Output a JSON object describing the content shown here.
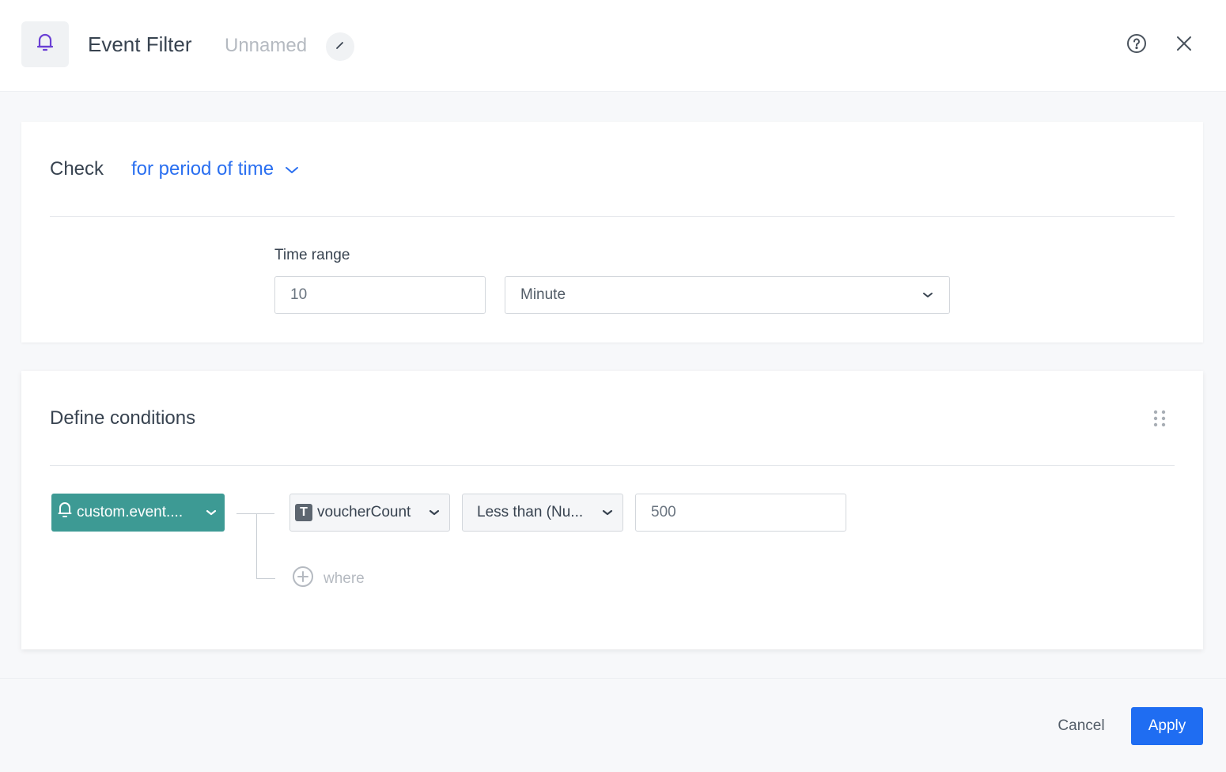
{
  "header": {
    "icon": "bell-icon",
    "title": "Event Filter",
    "subtitle": "Unnamed",
    "edit_icon": "pencil-icon",
    "help_icon": "help-circle-icon",
    "close_icon": "close-icon"
  },
  "check_section": {
    "label": "Check",
    "mode_value": "for period of time",
    "time_range": {
      "label": "Time range",
      "value": "10",
      "unit": "Minute"
    }
  },
  "conditions_section": {
    "title": "Define conditions",
    "event_chip": {
      "icon": "bell-icon",
      "label": "custom.event...."
    },
    "condition": {
      "parameter_type_icon": "T",
      "parameter": "voucherCount",
      "operator": "Less than (Nu...",
      "value": "500"
    },
    "add_where_label": "where"
  },
  "footer": {
    "cancel_label": "Cancel",
    "apply_label": "Apply"
  },
  "colors": {
    "accent_blue": "#2a6ff0",
    "apply_button": "#1f6df2",
    "event_chip": "#3d9a94",
    "bell_icon_purple": "#6a3fd4"
  }
}
